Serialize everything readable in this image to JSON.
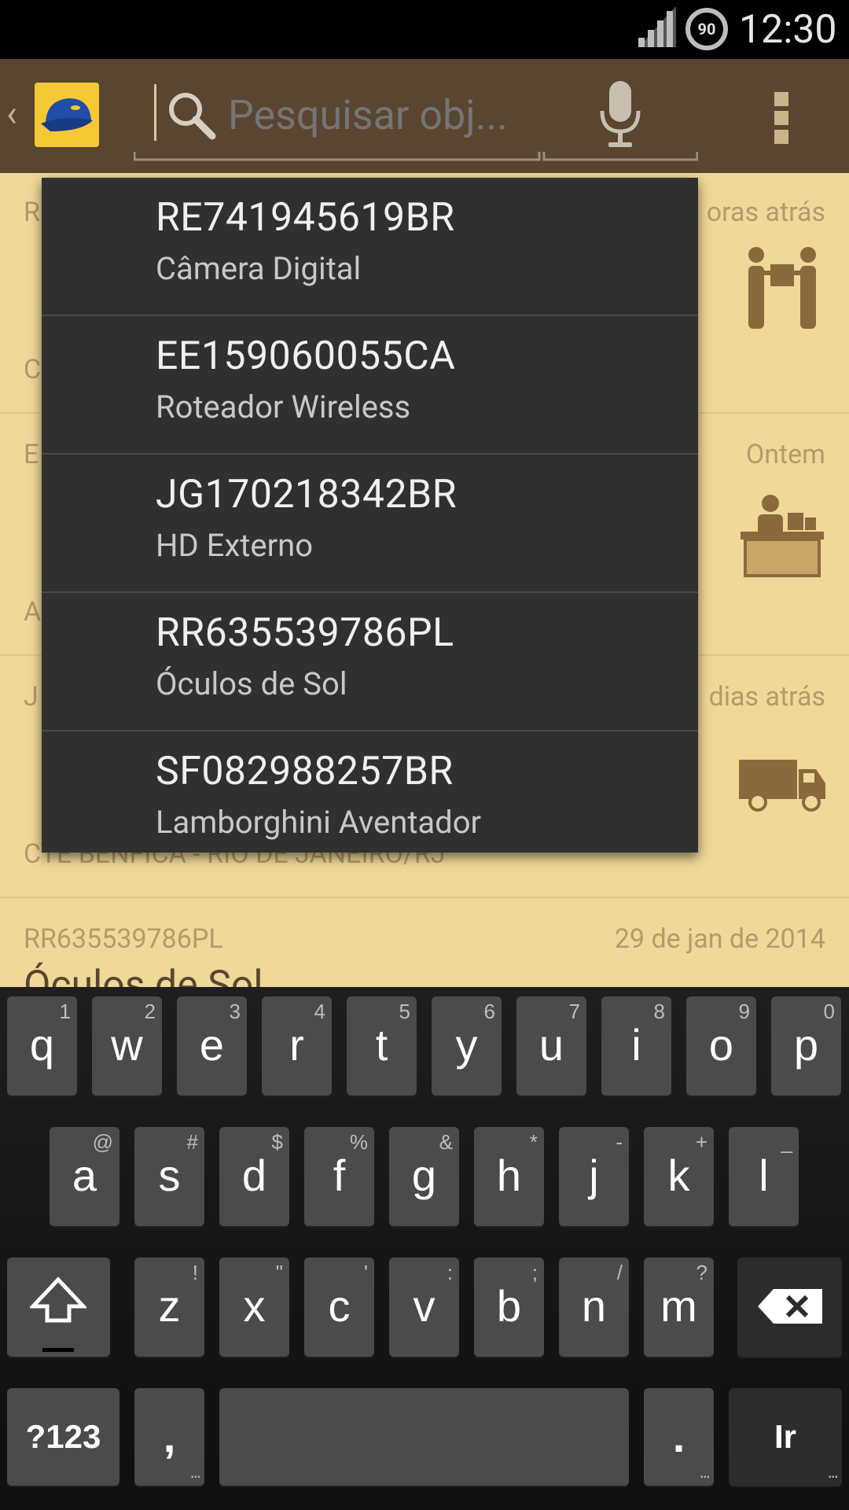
{
  "status_bar": {
    "time": "12:30",
    "battery": "90"
  },
  "action_bar": {
    "search_placeholder": "Pesquisar obj..."
  },
  "list": {
    "items": [
      {
        "code": "R",
        "date": "oras atrás",
        "title": "",
        "location": "C"
      },
      {
        "code": "E",
        "date": "Ontem",
        "title": "",
        "location": "A"
      },
      {
        "code": "J",
        "date": "dias atrás",
        "title": "",
        "location": "CTE BENFICA - RIO DE JANEIRO/RJ"
      },
      {
        "code": "RR635539786PL",
        "date": "29 de jan de 2014",
        "title": "Óculos de Sol",
        "location": ""
      }
    ]
  },
  "suggestions": [
    {
      "code": "RE741945619BR",
      "name": "Câmera Digital"
    },
    {
      "code": "EE159060055CA",
      "name": "Roteador Wireless"
    },
    {
      "code": "JG170218342BR",
      "name": "HD Externo"
    },
    {
      "code": "RR635539786PL",
      "name": "Óculos de Sol"
    },
    {
      "code": "SF082988257BR",
      "name": "Lamborghini Aventador"
    }
  ],
  "keyboard": {
    "row1": [
      {
        "key": "q",
        "hint": "1"
      },
      {
        "key": "w",
        "hint": "2"
      },
      {
        "key": "e",
        "hint": "3"
      },
      {
        "key": "r",
        "hint": "4"
      },
      {
        "key": "t",
        "hint": "5"
      },
      {
        "key": "y",
        "hint": "6"
      },
      {
        "key": "u",
        "hint": "7"
      },
      {
        "key": "i",
        "hint": "8"
      },
      {
        "key": "o",
        "hint": "9"
      },
      {
        "key": "p",
        "hint": "0"
      }
    ],
    "row2": [
      {
        "key": "a",
        "hint": "@"
      },
      {
        "key": "s",
        "hint": "#"
      },
      {
        "key": "d",
        "hint": "$"
      },
      {
        "key": "f",
        "hint": "%"
      },
      {
        "key": "g",
        "hint": "&"
      },
      {
        "key": "h",
        "hint": "*"
      },
      {
        "key": "j",
        "hint": "-"
      },
      {
        "key": "k",
        "hint": "+"
      },
      {
        "key": "l",
        "hint": "_"
      }
    ],
    "row3": [
      {
        "key": "z",
        "hint": "!"
      },
      {
        "key": "x",
        "hint": "\""
      },
      {
        "key": "c",
        "hint": "'"
      },
      {
        "key": "v",
        "hint": ":"
      },
      {
        "key": "b",
        "hint": ";"
      },
      {
        "key": "n",
        "hint": "/"
      },
      {
        "key": "m",
        "hint": "?"
      }
    ],
    "symbols_label": "?123",
    "comma_label": ",",
    "period_label": ".",
    "go_label": "Ir"
  }
}
